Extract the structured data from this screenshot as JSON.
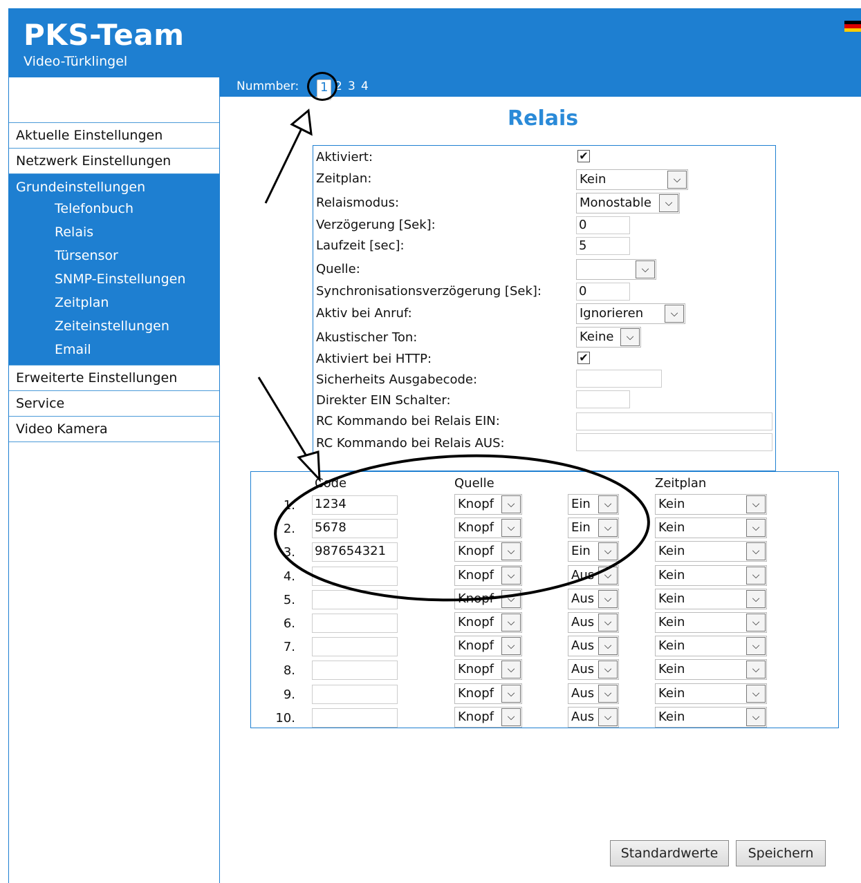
{
  "header": {
    "brand": "PKS-Team",
    "subtitle": "Video-Türklingel"
  },
  "numbar": {
    "label": "Nummber:",
    "numbers": [
      "1",
      "2",
      "3",
      "4"
    ],
    "selected": "1"
  },
  "sidebar": {
    "items_top": [
      "Aktuelle Einstellungen",
      "Netzwerk Einstellungen"
    ],
    "group": {
      "label": "Grundeinstellungen",
      "subitems": [
        "Telefonbuch",
        "Relais",
        "Türsensor",
        "SNMP-Einstellungen",
        "Zeitplan",
        "Zeiteinstellungen",
        "Email"
      ]
    },
    "items_bottom": [
      "Erweiterte Einstellungen",
      "Service",
      "Video Kamera"
    ]
  },
  "page_title": "Relais",
  "settings": {
    "aktiviert": {
      "label": "Aktiviert:",
      "checked": true
    },
    "zeitplan": {
      "label": "Zeitplan:",
      "value": "Kein"
    },
    "relaismodus": {
      "label": "Relaismodus:",
      "value": "Monostable"
    },
    "verzoegerung": {
      "label": "Verzögerung [Sek]:",
      "value": "0"
    },
    "laufzeit": {
      "label": "Laufzeit [sec]:",
      "value": "5"
    },
    "quelle": {
      "label": "Quelle:",
      "value": ""
    },
    "sync": {
      "label": "Synchronisationsverzögerung [Sek]:",
      "value": "0"
    },
    "aktiv_anruf": {
      "label": "Aktiv bei Anruf:",
      "value": "Ignorieren"
    },
    "ton": {
      "label": "Akustischer Ton:",
      "value": "Keine"
    },
    "http": {
      "label": "Aktiviert bei HTTP:",
      "checked": true
    },
    "sicherheit": {
      "label": "Sicherheits Ausgabecode:",
      "value": ""
    },
    "direkt": {
      "label": "Direkter EIN Schalter:",
      "value": ""
    },
    "rc_ein": {
      "label": "RC Kommando bei Relais EIN:",
      "value": ""
    },
    "rc_aus": {
      "label": "RC Kommando bei Relais AUS:",
      "value": ""
    }
  },
  "codes_table": {
    "headers": {
      "code": "Code",
      "quelle": "Quelle",
      "zeitplan": "Zeitplan"
    },
    "rows": [
      {
        "idx": "1.",
        "code": "1234",
        "quelle": "Knopf",
        "state": "Ein",
        "zeitplan": "Kein"
      },
      {
        "idx": "2.",
        "code": "5678",
        "quelle": "Knopf",
        "state": "Ein",
        "zeitplan": "Kein"
      },
      {
        "idx": "3.",
        "code": "987654321",
        "quelle": "Knopf",
        "state": "Ein",
        "zeitplan": "Kein"
      },
      {
        "idx": "4.",
        "code": "",
        "quelle": "Knopf",
        "state": "Aus",
        "zeitplan": "Kein"
      },
      {
        "idx": "5.",
        "code": "",
        "quelle": "Knopf",
        "state": "Aus",
        "zeitplan": "Kein"
      },
      {
        "idx": "6.",
        "code": "",
        "quelle": "Knopf",
        "state": "Aus",
        "zeitplan": "Kein"
      },
      {
        "idx": "7.",
        "code": "",
        "quelle": "Knopf",
        "state": "Aus",
        "zeitplan": "Kein"
      },
      {
        "idx": "8.",
        "code": "",
        "quelle": "Knopf",
        "state": "Aus",
        "zeitplan": "Kein"
      },
      {
        "idx": "9.",
        "code": "",
        "quelle": "Knopf",
        "state": "Aus",
        "zeitplan": "Kein"
      },
      {
        "idx": "10.",
        "code": "",
        "quelle": "Knopf",
        "state": "Aus",
        "zeitplan": "Kein"
      }
    ]
  },
  "buttons": {
    "defaults": "Standardwerte",
    "save": "Speichern"
  },
  "colors": {
    "accent": "#1e7fd1",
    "title": "#2a8ad8"
  }
}
